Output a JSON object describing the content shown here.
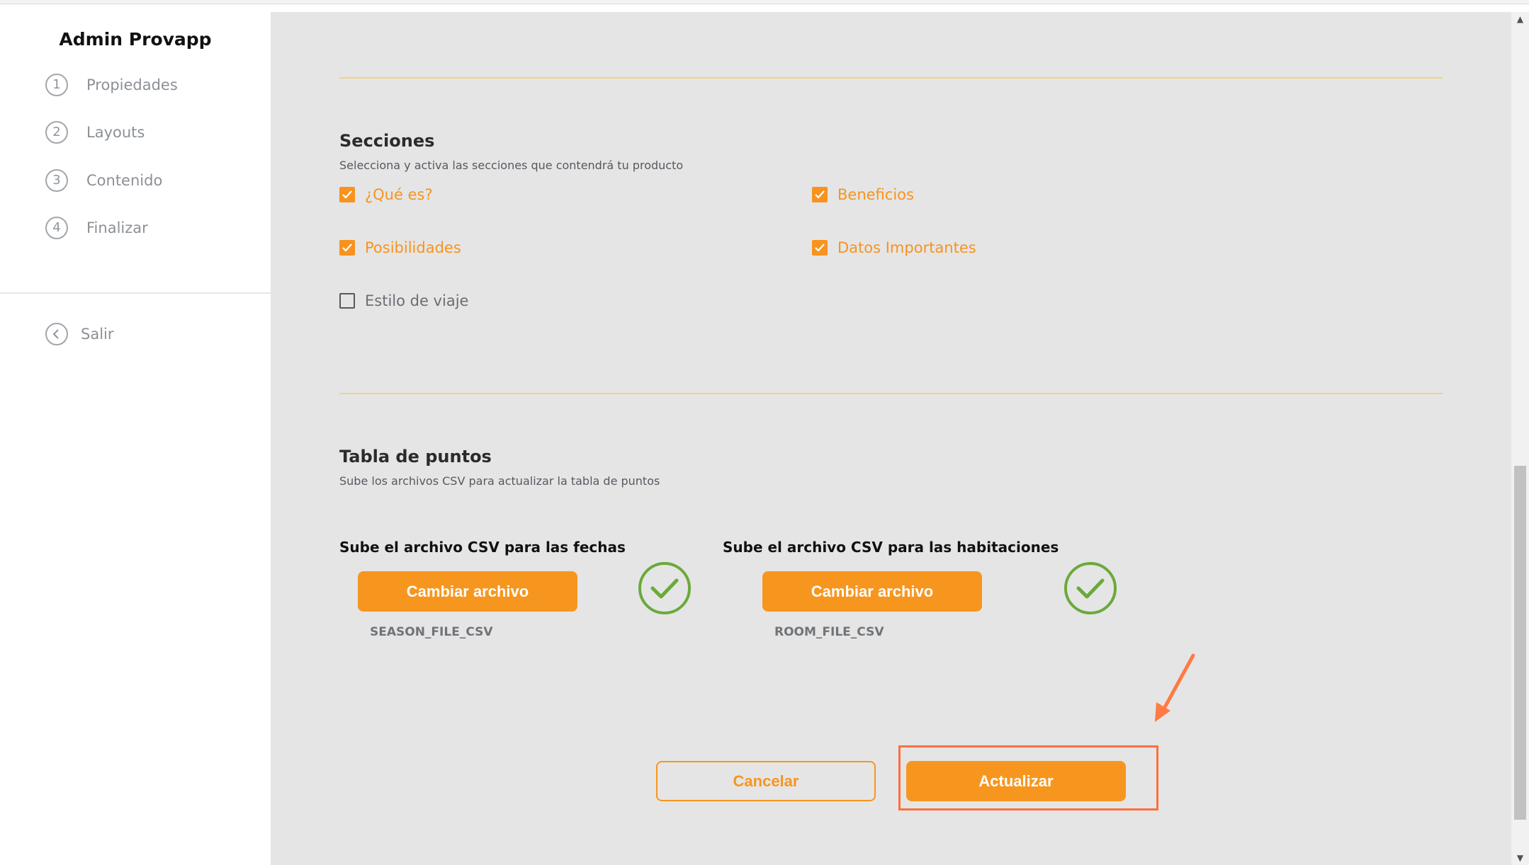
{
  "sidebar": {
    "brand": "Admin Provapp",
    "steps": [
      {
        "num": "1",
        "label": "Propiedades"
      },
      {
        "num": "2",
        "label": "Layouts"
      },
      {
        "num": "3",
        "label": "Contenido"
      },
      {
        "num": "4",
        "label": "Finalizar"
      }
    ],
    "exit_label": "Salir"
  },
  "sections": {
    "title": "Secciones",
    "subtitle": "Selecciona y activa las secciones que contendrá tu producto",
    "options": [
      {
        "label": "¿Qué es?",
        "checked": true
      },
      {
        "label": "Beneficios",
        "checked": true
      },
      {
        "label": "Posibilidades",
        "checked": true
      },
      {
        "label": "Datos Importantes",
        "checked": true
      },
      {
        "label": "Estilo de viaje",
        "checked": false
      }
    ]
  },
  "points_table": {
    "title": "Tabla de puntos",
    "subtitle": "Sube los archivos CSV para actualizar la tabla de puntos",
    "uploads": [
      {
        "title": "Sube el archivo CSV para las fechas",
        "button": "Cambiar archivo",
        "file": "SEASON_FILE_CSV",
        "status": "uploaded"
      },
      {
        "title": "Sube el archivo CSV para las habitaciones",
        "button": "Cambiar archivo",
        "file": "ROOM_FILE_CSV",
        "status": "uploaded"
      }
    ]
  },
  "actions": {
    "cancel": "Cancelar",
    "update": "Actualizar"
  },
  "colors": {
    "accent": "#f7961f",
    "success": "#6aaa3a",
    "annotation": "#ff6f3d"
  }
}
